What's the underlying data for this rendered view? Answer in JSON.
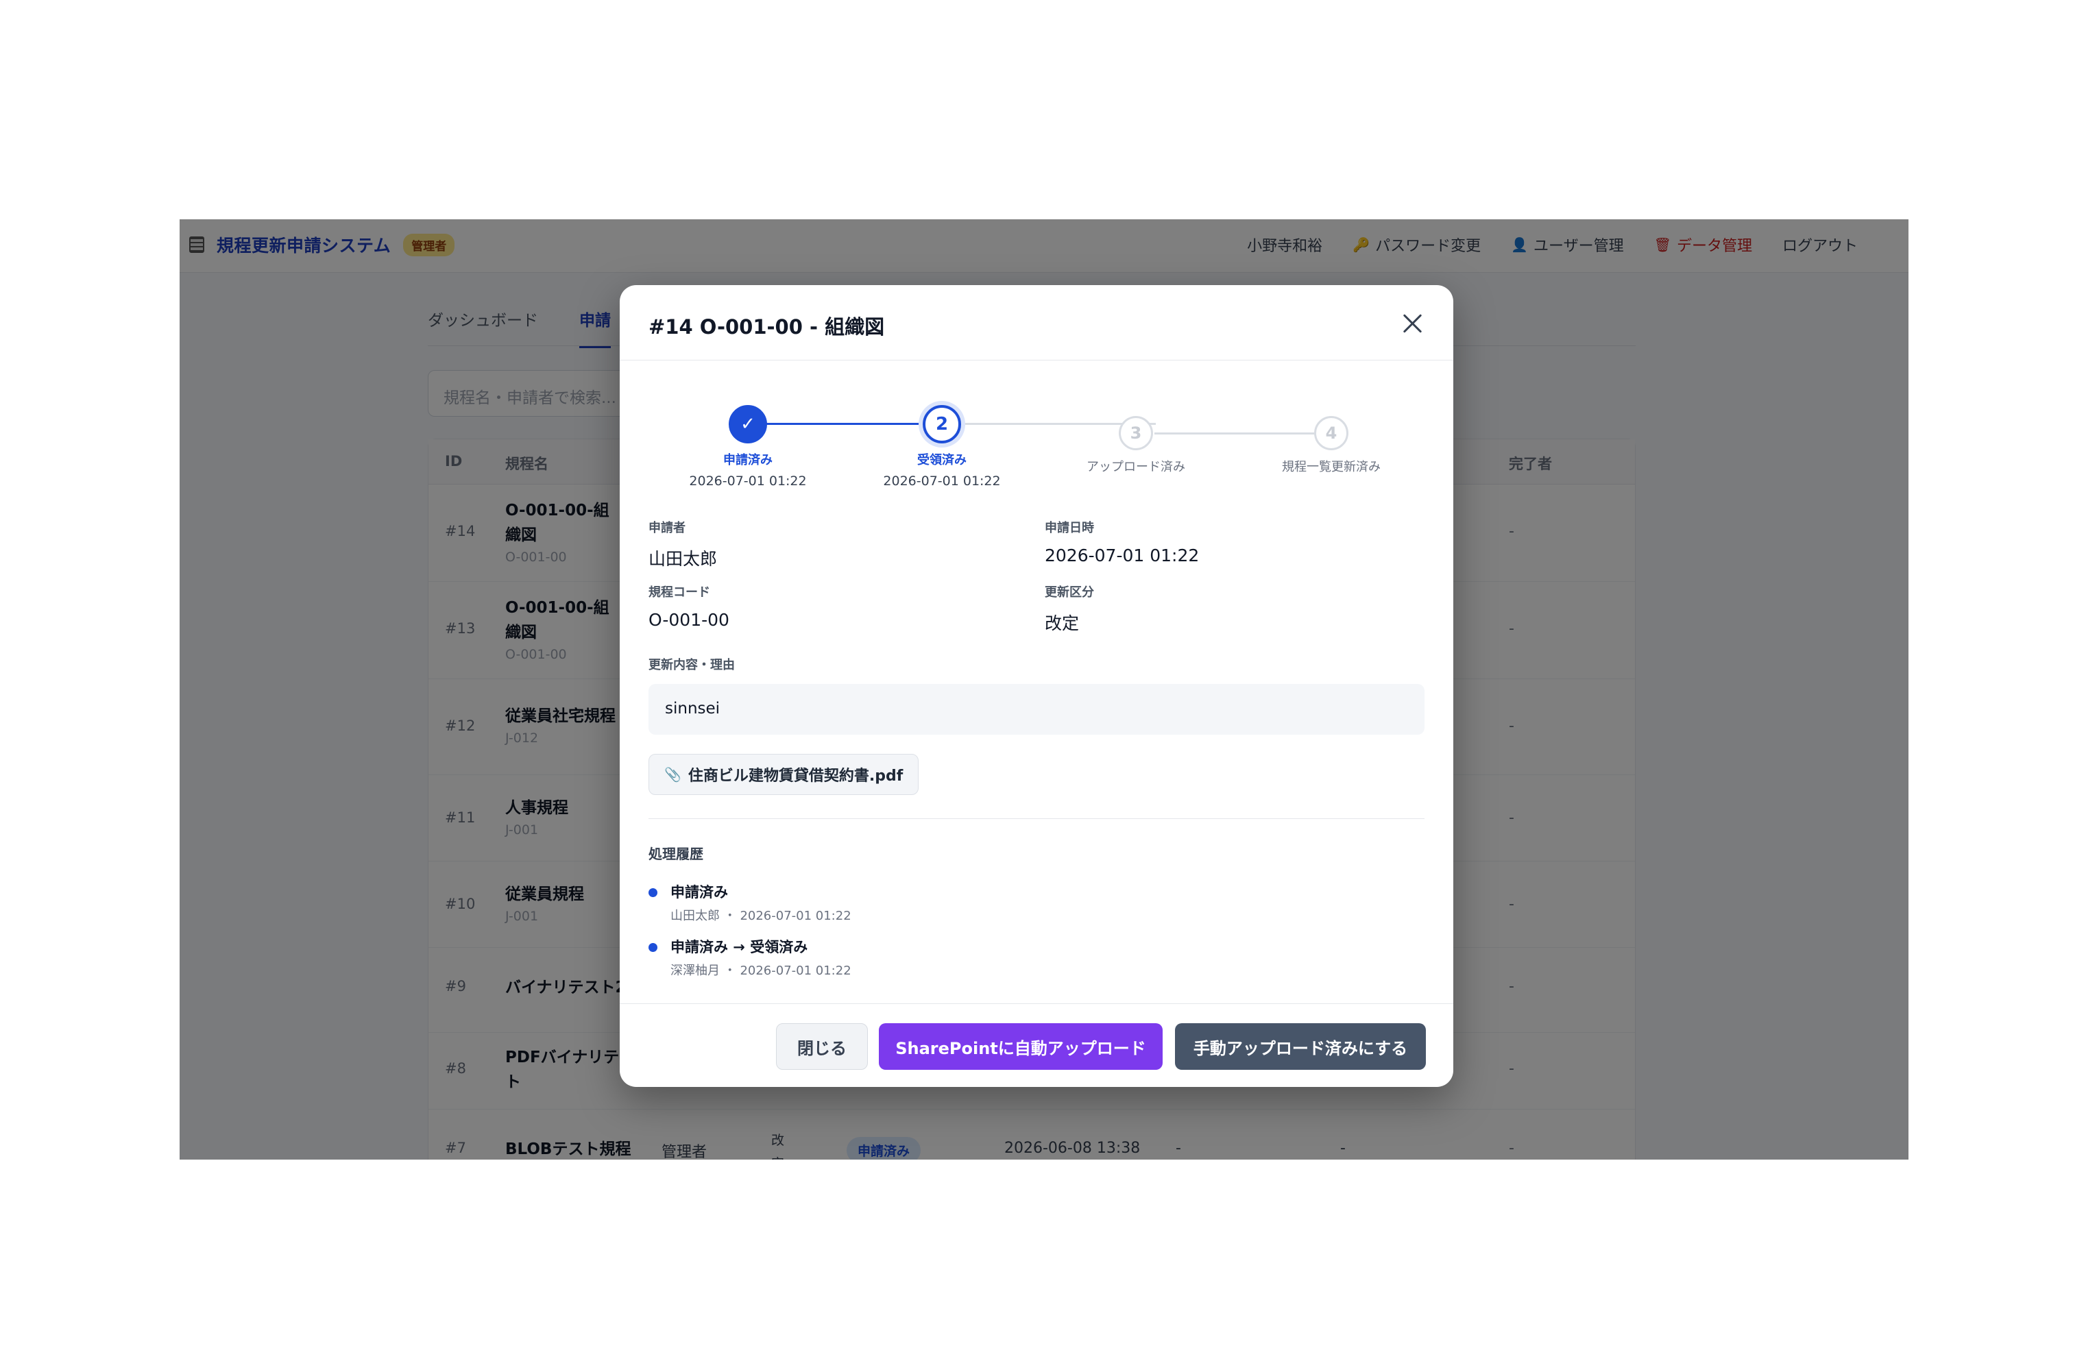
{
  "header": {
    "app_title": "規程更新申請システム",
    "role_badge": "管理者",
    "user_name": "小野寺和裕",
    "nav": [
      {
        "label": "パスワード変更",
        "icon": "key-icon"
      },
      {
        "label": "ユーザー管理",
        "icon": "user-icon"
      },
      {
        "label": "データ管理",
        "icon": "trash-icon"
      },
      {
        "label": "ログアウト"
      }
    ]
  },
  "tabs": [
    {
      "label": "ダッシュボード"
    },
    {
      "label": "申請"
    }
  ],
  "search": {
    "placeholder": "規程名・申請者で検索..."
  },
  "table": {
    "headers": {
      "id": "ID",
      "name": "規程名",
      "completer": "完了者"
    },
    "rows": [
      {
        "id": "#14",
        "name": "O-001-00-組織図",
        "code": "O-001-00",
        "completer": "-"
      },
      {
        "id": "#13",
        "name": "O-001-00-組織図",
        "code": "O-001-00",
        "completer": "-"
      },
      {
        "id": "#12",
        "name": "従業員社宅規程",
        "code": "J-012",
        "completer": "-"
      },
      {
        "id": "#11",
        "name": "人事規程",
        "code": "J-001",
        "completer": "-"
      },
      {
        "id": "#10",
        "name": "従業員規程",
        "code": "J-001",
        "completer": "-"
      },
      {
        "id": "#9",
        "name": "バイナリテスト2",
        "code": "",
        "completer": "-"
      },
      {
        "id": "#8",
        "name": "PDFバイナリテスト",
        "code": "",
        "completer": "-"
      },
      {
        "id": "#7",
        "name": "BLOBテスト規程",
        "code": "",
        "applicant": "管理者",
        "type": "改定",
        "status": "申請済み",
        "datetime": "2026-06-08 13:38",
        "col_a": "-",
        "col_b": "-",
        "completer": "-"
      }
    ]
  },
  "modal": {
    "title": "#14 O-001-00 - 組織図",
    "steps": [
      {
        "num": "✓",
        "label": "申請済み",
        "date": "2026-07-01 01:22",
        "state": "done"
      },
      {
        "num": "2",
        "label": "受領済み",
        "date": "2026-07-01 01:22",
        "state": "current"
      },
      {
        "num": "3",
        "label": "アップロード済み",
        "date": "",
        "state": "todo"
      },
      {
        "num": "4",
        "label": "規程一覧更新済み",
        "date": "",
        "state": "todo"
      }
    ],
    "fields": {
      "applicant_label": "申請者",
      "applicant": "山田太郎",
      "datetime_label": "申請日時",
      "datetime": "2026-07-01 01:22",
      "code_label": "規程コード",
      "code": "O-001-00",
      "type_label": "更新区分",
      "type": "改定"
    },
    "reason_label": "更新内容・理由",
    "reason": "sinnsei",
    "attachment": "住商ビル建物賃貸借契約書.pdf",
    "history_title": "処理履歴",
    "history": [
      {
        "action": "申請済み",
        "meta": "山田太郎 ・ 2026-07-01 01:22"
      },
      {
        "action": "申請済み → 受領済み",
        "meta": "深澤柚月 ・ 2026-07-01 01:22"
      }
    ],
    "buttons": {
      "close": "閉じる",
      "sharepoint": "SharePointに自動アップロード",
      "manual": "手動アップロード済みにする"
    }
  },
  "colors": {
    "primary": "#1d4ed8",
    "sharepoint_button": "#7c3aed",
    "manual_button": "#475569",
    "danger": "#c81e1e"
  }
}
